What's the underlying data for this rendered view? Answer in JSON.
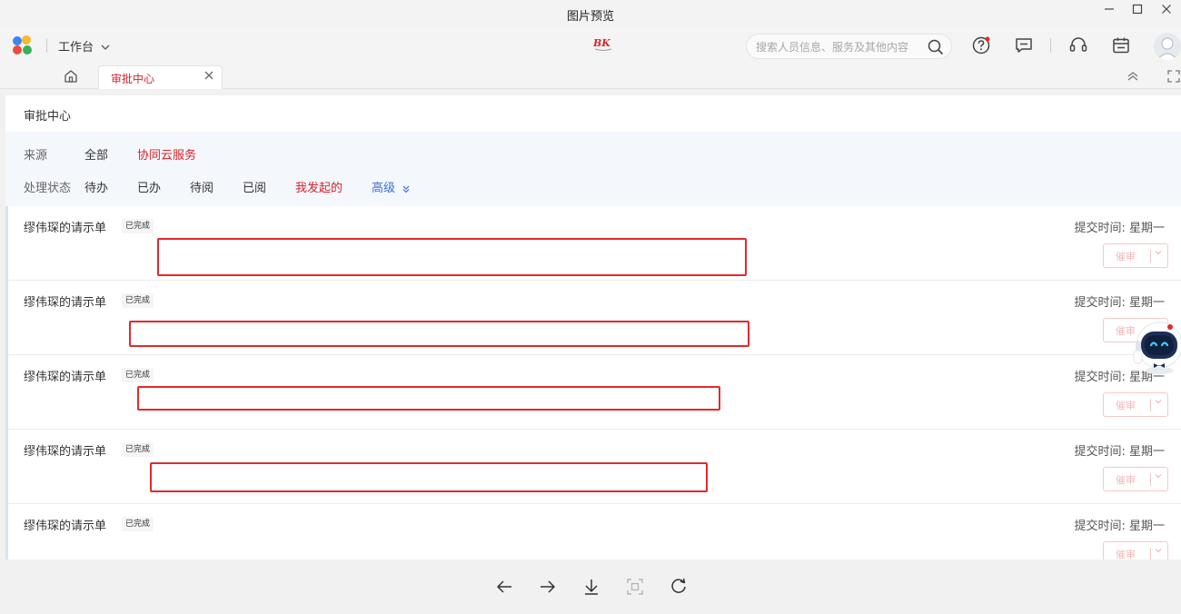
{
  "window": {
    "title": "图片预览"
  },
  "header": {
    "workspace_label": "工作台",
    "search_placeholder": "搜索人员信息、服务及其他内容"
  },
  "tabs": [
    {
      "label": "审批中心"
    }
  ],
  "panel": {
    "title": "审批中心"
  },
  "filters": {
    "source_label": "来源",
    "source_options": [
      "全部",
      "协同云服务"
    ],
    "source_active": "协同云服务",
    "status_label": "处理状态",
    "status_options": [
      "待办",
      "已办",
      "待阅",
      "已阅",
      "我发起的"
    ],
    "status_active": "我发起的",
    "advanced_label": "高级"
  },
  "items": [
    {
      "title": "缪伟琛的请示单",
      "badge": "已完成",
      "time": "提交时间: 星期一",
      "action": "催审"
    },
    {
      "title": "缪伟琛的请示单",
      "badge": "已完成",
      "time": "提交时间: 星期一",
      "action": "催审"
    },
    {
      "title": "缪伟琛的请示单",
      "badge": "已完成",
      "time": "提交时间: 星期一",
      "action": "催审"
    },
    {
      "title": "缪伟琛的请示单",
      "badge": "已完成",
      "time": "提交时间: 星期一",
      "action": "催审"
    },
    {
      "title": "缪伟琛的请示单",
      "badge": "已完成",
      "time": "提交时间: 星期一",
      "action": "催审"
    }
  ],
  "colors": {
    "accent_red": "#d9242c",
    "advanced_blue": "#3a6fd8",
    "redaction_red": "#e4292b"
  },
  "icons": {
    "minimize": "minimize-icon",
    "maximize": "maximize-icon",
    "close": "close-icon",
    "help": "help-icon",
    "message": "message-icon",
    "headset": "headset-icon",
    "calendar": "calendar-icon",
    "prev": "arrow-left-icon",
    "next": "arrow-right-icon",
    "download": "download-icon",
    "fit": "fit-screen-icon",
    "rotate": "rotate-icon"
  }
}
